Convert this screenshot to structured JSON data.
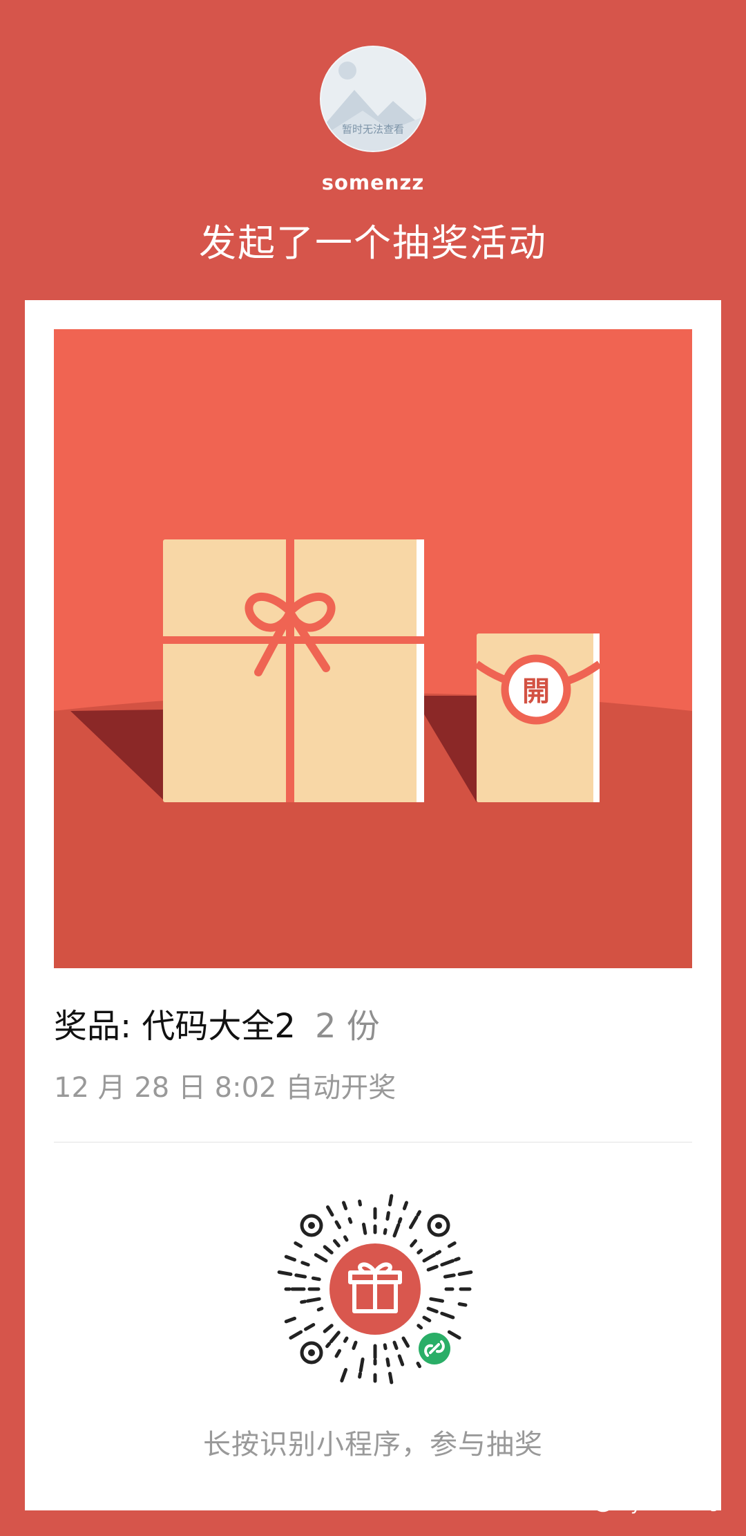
{
  "header": {
    "avatar_placeholder": "暂时无法查看",
    "username": "somenzz",
    "headline": "发起了一个抽奖活动"
  },
  "banner": {
    "envelope_char": "開"
  },
  "prize": {
    "label": "奖品: 代码大全2",
    "count": "2 份"
  },
  "draw_time": "12 月 28 日 8:02 自动开奖",
  "qr_hint": "长按识别小程序，参与抽奖",
  "watermark": "Python七号",
  "colors": {
    "page_bg": "#d6554b",
    "banner_sky": "#f06452",
    "banner_ground": "#d35243",
    "gift_box": "#f8d7a6",
    "ribbon": "#ef6453",
    "shadow": "#8b2827",
    "qr_center": "#d9574e",
    "miniprogram_badge": "#2aae67"
  }
}
